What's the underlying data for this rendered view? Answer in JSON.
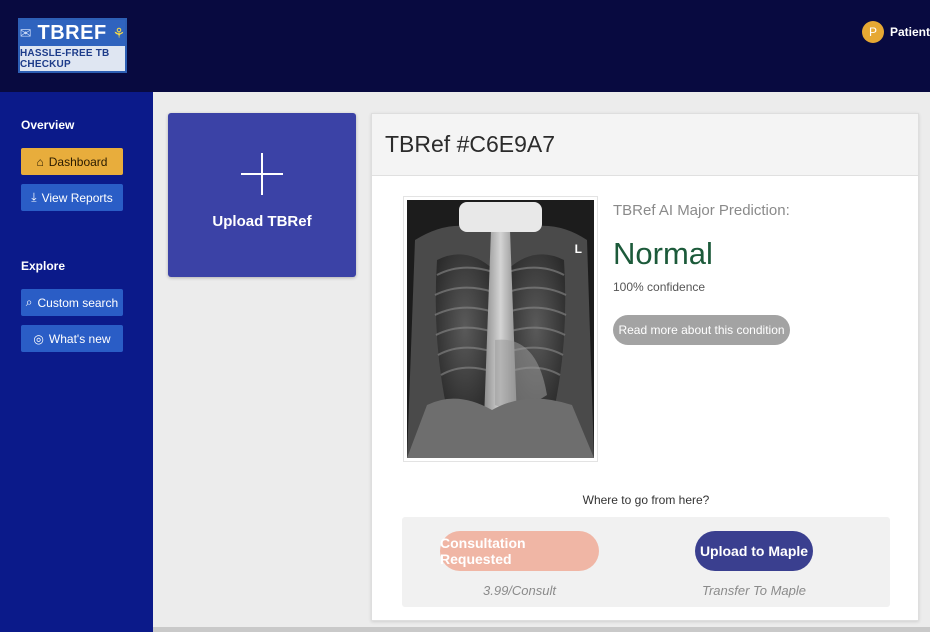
{
  "header": {
    "logo": {
      "title": "TBREF",
      "subtitle": "HASSLE-FREE TB CHECKUP",
      "pill_icon": "pill-icon",
      "lung_icon": "lungs-icon"
    },
    "user": {
      "initial": "P",
      "name": "Patient"
    }
  },
  "sidebar": {
    "overview_label": "Overview",
    "explore_label": "Explore",
    "items": [
      {
        "label": "Dashboard",
        "icon": "home-icon",
        "active": true
      },
      {
        "label": "View Reports",
        "icon": "download-icon",
        "active": false
      },
      {
        "label": "Custom search",
        "icon": "search-icon",
        "active": false
      },
      {
        "label": "What's new",
        "icon": "compass-icon",
        "active": false
      }
    ]
  },
  "upload": {
    "label": "Upload TBRef",
    "icon": "plus-icon"
  },
  "result": {
    "title": "TBRef #C6E9A7",
    "prediction_label": "TBRef AI Major Prediction:",
    "prediction": "Normal",
    "confidence": "100% confidence",
    "read_more": "Read more about this condition",
    "xray_marker": "L",
    "where_next": "Where to go from here?",
    "actions": [
      {
        "label": "Consultation Requested",
        "sub": "3.99/Consult"
      },
      {
        "label": "Upload to Maple",
        "sub": "Transfer To Maple"
      }
    ]
  },
  "colors": {
    "header_bg": "#080a40",
    "sidebar_bg": "#0b1a8a",
    "active_item": "#e8ad3c",
    "upload_card": "#3b42a6",
    "prediction_text": "#1c5a3a",
    "consult_button": "#f0b6a5",
    "maple_button": "#3a3f8f"
  }
}
